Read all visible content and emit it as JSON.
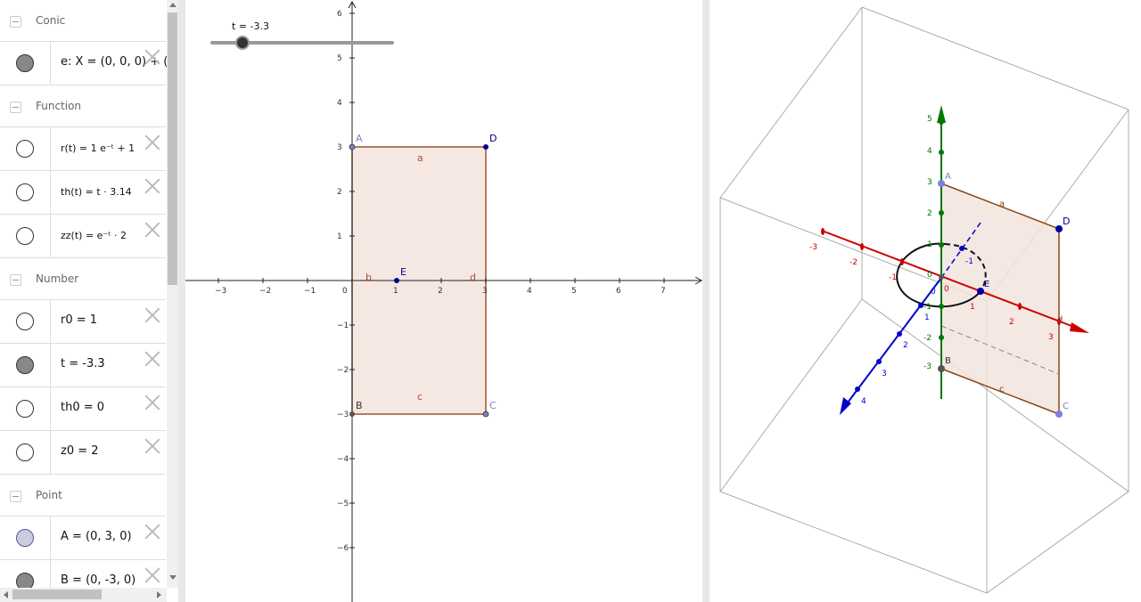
{
  "algebra": {
    "groups": [
      {
        "name": "Conic",
        "items": [
          {
            "expr": "e: X = (0, 0, 0) + (",
            "state": "on"
          }
        ]
      },
      {
        "name": "Function",
        "items": [
          {
            "expr": "r(t) = 1 e⁻ᵗ + 1",
            "state": "off"
          },
          {
            "expr": "th(t) = t · 3.14",
            "state": "off"
          },
          {
            "expr": "zz(t) = e⁻ᵗ · 2",
            "state": "off"
          }
        ]
      },
      {
        "name": "Number",
        "items": [
          {
            "expr": "r0 = 1",
            "state": "off"
          },
          {
            "expr": "t = -3.3",
            "state": "on"
          },
          {
            "expr": "th0 = 0",
            "state": "off"
          },
          {
            "expr": "z0 = 2",
            "state": "off"
          }
        ]
      },
      {
        "name": "Point",
        "items": [
          {
            "expr": "A = (0, 3, 0)",
            "state": "on-blue"
          },
          {
            "expr": "B = (0, -3, 0)",
            "state": "on"
          }
        ]
      }
    ]
  },
  "graphics2d": {
    "slider_label": "t = -3.3",
    "x_ticks": [
      "−3",
      "−2",
      "−1",
      "0",
      "1",
      "2",
      "3",
      "4",
      "5",
      "6",
      "7"
    ],
    "y_ticks": [
      "6",
      "5",
      "4",
      "3",
      "2",
      "1",
      "−1",
      "−2",
      "−3",
      "−4",
      "−5",
      "−6"
    ],
    "points": {
      "A": "A",
      "B": "B",
      "C": "C",
      "D": "D",
      "E": "E"
    },
    "segments": {
      "a": "a",
      "b": "b",
      "c": "c",
      "d": "d"
    },
    "colors": {
      "rect_fill": "#f5e8e2",
      "rect_stroke": "#a0522d",
      "point_blue": "#00008b",
      "point_light": "#7f7fbf"
    }
  },
  "graphics3d": {
    "x_ticks": [
      "-3",
      "-2",
      "-1",
      "1",
      "2",
      "3"
    ],
    "y_ticks": [
      "-1",
      "1",
      "2",
      "3",
      "4"
    ],
    "z_ticks": [
      "5",
      "4",
      "3",
      "2",
      "1",
      "-1",
      "-2",
      "-3"
    ],
    "origin_labels": {
      "zero_a": "0",
      "zero_b": "0",
      "zero_c": "0"
    },
    "points": {
      "A": "A",
      "B": "B",
      "C": "C",
      "D": "D",
      "E": "E"
    },
    "segments": {
      "a": "a",
      "c": "c",
      "d": "d"
    },
    "colors": {
      "x_axis": "#cc0000",
      "y_axis": "#0000cc",
      "z_axis": "#006600"
    }
  }
}
